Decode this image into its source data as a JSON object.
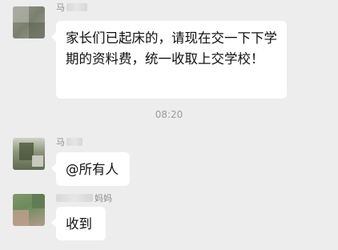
{
  "chat": {
    "messages": [
      {
        "sender": "马",
        "text": "家长们已起床的，请现在交一下下学期的资料费，统一收取上交学校！"
      },
      {
        "sender": "马",
        "text": "@所有人"
      },
      {
        "sender": "妈妈",
        "text": "收到"
      }
    ],
    "timestamp": "08:20"
  }
}
